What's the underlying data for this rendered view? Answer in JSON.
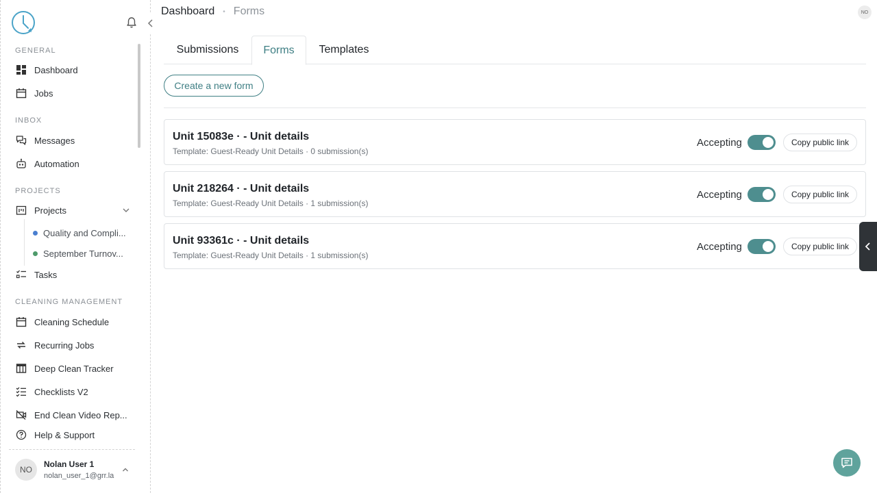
{
  "breadcrumb": {
    "home": "Dashboard",
    "separator": "•",
    "current": "Forms"
  },
  "top_avatar_initials": "NO",
  "sidebar": {
    "sections": {
      "general": "GENERAL",
      "inbox": "INBOX",
      "projects": "PROJECTS",
      "cleaning": "CLEANING MANAGEMENT"
    },
    "items": {
      "dashboard": "Dashboard",
      "jobs": "Jobs",
      "messages": "Messages",
      "automation": "Automation",
      "projects": "Projects",
      "tasks": "Tasks",
      "cleaning_schedule": "Cleaning Schedule",
      "recurring_jobs": "Recurring Jobs",
      "deep_clean_tracker": "Deep Clean Tracker",
      "checklists_v2": "Checklists V2",
      "end_clean_video": "End Clean Video Rep...",
      "help_support": "Help & Support"
    },
    "sub_projects": [
      {
        "label": "Quality and Compli...",
        "color": "#4a7fd0"
      },
      {
        "label": "September Turnov...",
        "color": "#4e9a6b"
      }
    ],
    "user": {
      "initials": "NO",
      "name": "Nolan User 1",
      "email": "nolan_user_1@grr.la"
    }
  },
  "tabs": [
    {
      "label": "Submissions",
      "active": false
    },
    {
      "label": "Forms",
      "active": true
    },
    {
      "label": "Templates",
      "active": false
    }
  ],
  "create_button": "Create a new form",
  "forms": [
    {
      "title": "Unit 15083e · - Unit details",
      "meta": "Template: Guest-Ready Unit Details · 0 submission(s)",
      "status_label": "Accepting",
      "accepting": true,
      "copy_label": "Copy public link"
    },
    {
      "title": "Unit 218264 · - Unit details",
      "meta": "Template: Guest-Ready Unit Details · 1 submission(s)",
      "status_label": "Accepting",
      "accepting": true,
      "copy_label": "Copy public link"
    },
    {
      "title": "Unit 93361c · - Unit details",
      "meta": "Template: Guest-Ready Unit Details · 1 submission(s)",
      "status_label": "Accepting",
      "accepting": true,
      "copy_label": "Copy public link"
    }
  ],
  "colors": {
    "accent": "#3f7f84",
    "toggle_on": "#4e8e8f",
    "chat_fab": "#5fa39c"
  }
}
